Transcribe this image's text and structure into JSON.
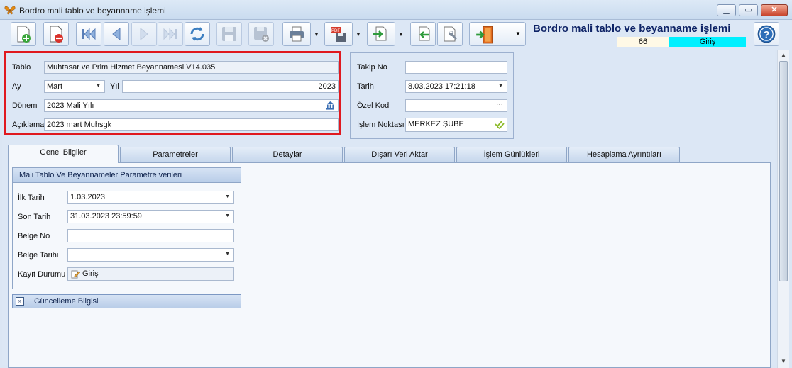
{
  "window": {
    "title": "Bordro mali tablo ve beyanname işlemi",
    "controls": {
      "minimize": "▭",
      "maximize": "▭",
      "close": "✕"
    }
  },
  "toolbar": {
    "form_title": "Bordro mali tablo ve beyanname işlemi",
    "record_count": "66",
    "mode": "Giriş",
    "buttons": [
      "new-record",
      "delete-record",
      "first-record",
      "previous-record",
      "next-record",
      "last-record",
      "refresh",
      "save",
      "cancel",
      "print",
      "export-pdf",
      "import",
      "transfer",
      "settings",
      "exit",
      "help"
    ]
  },
  "header": {
    "tablo_label": "Tablo",
    "tablo_value": "Muhtasar ve Prim Hizmet Beyannamesi V14.035",
    "ay_label": "Ay",
    "ay_value": "Mart",
    "yil_label": "Yıl",
    "yil_value": "2023",
    "donem_label": "Dönem",
    "donem_value": "2023 Mali Yılı",
    "aciklama_label": "Açıklama",
    "aciklama_value": "2023 mart Muhsgk"
  },
  "right_panel": {
    "takip_no_label": "Takip No",
    "takip_no_value": "",
    "tarih_label": "Tarih",
    "tarih_value": "8.03.2023 17:21:18",
    "ozel_kod_label": "Özel Kod",
    "ozel_kod_value": "",
    "islem_noktasi_label": "İşlem Noktası",
    "islem_noktasi_value": "MERKEZ ŞUBE"
  },
  "tabs": [
    {
      "label": "Genel Bilgiler",
      "active": true
    },
    {
      "label": "Parametreler",
      "active": false
    },
    {
      "label": "Detaylar",
      "active": false
    },
    {
      "label": "Dışarı Veri Aktar",
      "active": false
    },
    {
      "label": "İşlem Günlükleri",
      "active": false
    },
    {
      "label": "Hesaplama Ayrıntıları",
      "active": false
    }
  ],
  "param_group": {
    "title": "Mali Tablo Ve Beyannameler Parametre verileri",
    "ilk_tarih_label": "İlk Tarih",
    "ilk_tarih_value": "1.03.2023",
    "son_tarih_label": "Son Tarih",
    "son_tarih_value": "31.03.2023 23:59:59",
    "belge_no_label": "Belge No",
    "belge_no_value": "",
    "belge_tarihi_label": "Belge Tarihi",
    "belge_tarihi_value": "",
    "kayit_durumu_label": "Kayıt Durumu",
    "kayit_durumu_value": "Giriş"
  },
  "update_group": {
    "title": "Güncelleme Bilgisi"
  },
  "colors": {
    "highlight": "#e0191f",
    "mode_bg": "#00f0ff",
    "count_bg": "#fff9e6",
    "title_text": "#0e2366"
  }
}
